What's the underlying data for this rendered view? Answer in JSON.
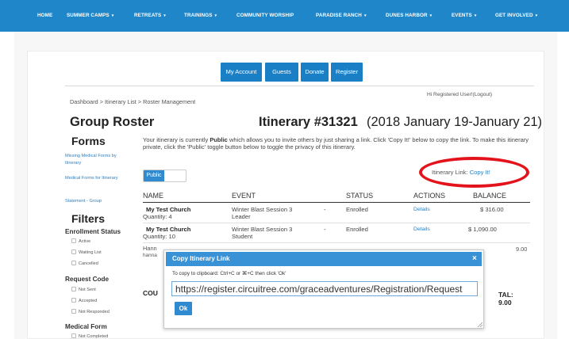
{
  "nav": {
    "items": [
      {
        "label": "HOME",
        "dropdown": false
      },
      {
        "label": "SUMMER CAMPS",
        "dropdown": true
      },
      {
        "label": "RETREATS",
        "dropdown": true
      },
      {
        "label": "TRAININGS",
        "dropdown": true
      },
      {
        "label": "COMMUNITY WORSHIP",
        "dropdown": false
      },
      {
        "label": "PARADISE RANCH",
        "dropdown": true
      },
      {
        "label": "DUNES HARBOR",
        "dropdown": true
      },
      {
        "label": "EVENTS",
        "dropdown": true
      },
      {
        "label": "GET INVOLVED",
        "dropdown": true
      }
    ],
    "caret": "▾"
  },
  "account_buttons": [
    "My Account",
    "Guests",
    "Donate",
    "Register"
  ],
  "breadcrumb": "Dashboard > Itinerary List > Roster Management",
  "welcome": "Hi Registered User!(Logout)",
  "page_title": "Group Roster",
  "itinerary_title": "Itinerary #31321",
  "itinerary_dates": "(2018 January 19-January 21)",
  "sidebar": {
    "forms_heading": "Forms",
    "forms_links": [
      "Missing Medical Forms by Itinerary",
      "Medical Forms for Itinerary",
      "Statement - Group"
    ],
    "filters_heading": "Filters",
    "groups": [
      {
        "heading": "Enrollment Status",
        "options": [
          "Active",
          "Waiting List",
          "Cancelled"
        ]
      },
      {
        "heading": "Request Code",
        "options": [
          "Not Sent",
          "Accepted",
          "Not Responded"
        ]
      },
      {
        "heading": "Medical Form",
        "options": [
          "Not Completed"
        ]
      }
    ]
  },
  "description": {
    "part1": "Your itinerary is currently ",
    "strong": "Public",
    "part2": " which allows you to invite others by just sharing a link. Click 'Copy It!' below to copy the link. To make this itinerary private, click the 'Public' toggle button below to toggle the privacy of this itinerary."
  },
  "toggle_label": "Public",
  "itinerary_link": {
    "label": "Itinerary Link: ",
    "action": "Copy It!"
  },
  "table": {
    "headers": [
      "NAME",
      "EVENT",
      "STATUS",
      "ACTIONS",
      "BALANCE"
    ],
    "rows": [
      {
        "name": "My Test Church",
        "quantity": "Quantity: 4",
        "event": "Winter Blast Session 3 Leader",
        "dash": "-",
        "status": "Enrolled",
        "action": "Details",
        "balance": "$ 316.00"
      },
      {
        "name": "My Test Church",
        "quantity": "Quantity: 10",
        "event": "Winter Blast Session 3 Student",
        "dash": "-",
        "status": "Enrolled",
        "action": "Details",
        "balance": "$ 1,090.00"
      }
    ]
  },
  "obscured": {
    "row3_name": "Hann",
    "row3_sub": "hanna",
    "row3_balance": "9.00",
    "cou_label": "COU",
    "total_label": "TAL:",
    "total_value": "9.00"
  },
  "modal": {
    "title": "Copy Itinerary Link",
    "close": "×",
    "hint": "To copy to clipboard: Ctrl+C or ⌘+C then click 'Ok'",
    "url": "https://register.circuitree.com/graceadventures/Registration/Request",
    "ok_label": "Ok"
  },
  "colors": {
    "nav_blue": "#1f86c9",
    "button_blue": "#1b7fc5",
    "link_blue": "#2d7fc0",
    "annotation_red": "#e3121b"
  }
}
